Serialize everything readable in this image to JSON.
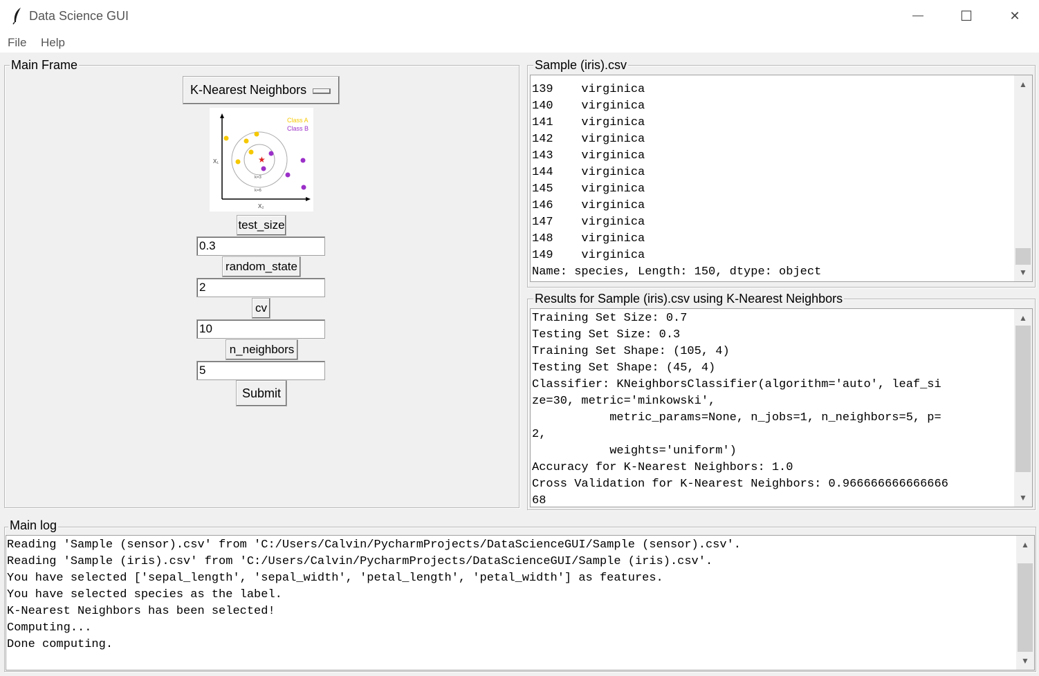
{
  "window": {
    "title": "Data Science GUI",
    "minimize_glyph": "—",
    "maximize_glyph": "☐",
    "close_glyph": "✕"
  },
  "menu": [
    "File",
    "Help"
  ],
  "main_frame": {
    "label": "Main Frame",
    "algorithm_select": "K-Nearest Neighbors",
    "illustration": {
      "legend": [
        "Class A",
        "Class B"
      ],
      "axis_labels": [
        "X₁",
        "X₂"
      ],
      "circle_labels": [
        "k=3",
        "k=6"
      ]
    },
    "params": [
      {
        "label": "test_size",
        "value": "0.3"
      },
      {
        "label": "random_state",
        "value": "2"
      },
      {
        "label": "cv",
        "value": "10"
      },
      {
        "label": "n_neighbors",
        "value": "5"
      }
    ],
    "submit_label": "Submit"
  },
  "sample_frame": {
    "label": "Sample (iris).csv",
    "lines": [
      "139    virginica",
      "140    virginica",
      "141    virginica",
      "142    virginica",
      "143    virginica",
      "144    virginica",
      "145    virginica",
      "146    virginica",
      "147    virginica",
      "148    virginica",
      "149    virginica",
      "Name: species, Length: 150, dtype: object"
    ]
  },
  "results_frame": {
    "label": "Results for Sample (iris).csv using K-Nearest Neighbors",
    "lines": [
      "Training Set Size: 0.7",
      "Testing Set Size: 0.3",
      "Training Set Shape: (105, 4)",
      "Testing Set Shape: (45, 4)",
      "Classifier: KNeighborsClassifier(algorithm='auto', leaf_si",
      "ze=30, metric='minkowski',",
      "           metric_params=None, n_jobs=1, n_neighbors=5, p=",
      "2,",
      "           weights='uniform')",
      "Accuracy for K-Nearest Neighbors: 1.0",
      "Cross Validation for K-Nearest Neighbors: 0.966666666666666",
      "68"
    ]
  },
  "main_log": {
    "label": "Main log",
    "lines": [
      "Reading 'Sample (sensor).csv' from 'C:/Users/Calvin/PycharmProjects/DataScienceGUI/Sample (sensor).csv'.",
      "Reading 'Sample (iris).csv' from 'C:/Users/Calvin/PycharmProjects/DataScienceGUI/Sample (iris).csv'.",
      "You have selected ['sepal_length', 'sepal_width', 'petal_length', 'petal_width'] as features.",
      "You have selected species as the label.",
      "K-Nearest Neighbors has been selected!",
      "Computing...",
      "Done computing."
    ]
  },
  "colors": {
    "class_a": "#f5c800",
    "class_b": "#9b30c8",
    "query_star": "#e02020"
  }
}
